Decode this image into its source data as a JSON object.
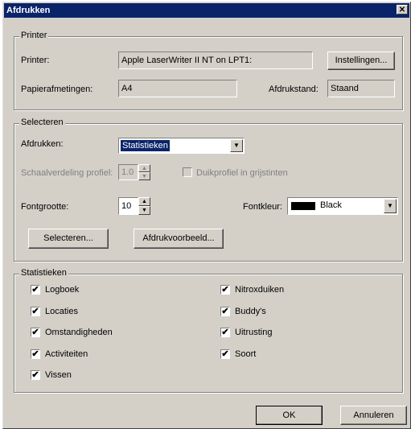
{
  "window": {
    "title": "Afdrukken",
    "close_glyph": "✕"
  },
  "printer_group": {
    "title": "Printer",
    "printer_label": "Printer:",
    "printer_value": "Apple LaserWriter II NT on LPT1:",
    "settings_button": "Instellingen...",
    "paper_label": "Papierafmetingen:",
    "paper_value": "A4",
    "orientation_label": "Afdrukstand:",
    "orientation_value": "Staand"
  },
  "select_group": {
    "title": "Selecteren",
    "print_label": "Afdrukken:",
    "print_value": "Statistieken",
    "scale_label": "Schaalverdeling profiel:",
    "scale_value": "1.0",
    "grayscale_label": "Duikprofiel in grijstinten",
    "fontsize_label": "Fontgrootte:",
    "fontsize_value": "10",
    "fontcolor_label": "Fontkleur:",
    "fontcolor_value": "Black",
    "fontcolor_swatch": "#000000",
    "select_button": "Selecteren...",
    "preview_button": "Afdrukvoorbeeld..."
  },
  "stats_group": {
    "title": "Statistieken",
    "items": [
      {
        "label": "Logboek",
        "checked": true
      },
      {
        "label": "Locaties",
        "checked": true
      },
      {
        "label": "Omstandigheden",
        "checked": true
      },
      {
        "label": "Activiteiten",
        "checked": true
      },
      {
        "label": "Vissen",
        "checked": true
      },
      {
        "label": "Nitroxduiken",
        "checked": true
      },
      {
        "label": "Buddy's",
        "checked": true
      },
      {
        "label": "Uitrusting",
        "checked": true
      },
      {
        "label": "Soort",
        "checked": true
      }
    ]
  },
  "footer": {
    "ok_button": "OK",
    "cancel_button": "Annuleren"
  },
  "colors": {
    "title_bar": "#0a246a",
    "face": "#d4d0c8",
    "selection": "#0a246a"
  },
  "check_glyph": "✔"
}
